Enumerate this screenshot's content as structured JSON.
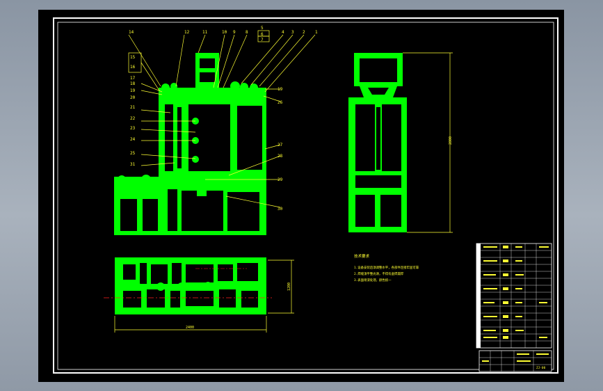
{
  "colors": {
    "background": "#000000",
    "part_fill": "#00ff00",
    "annotation": "#ffff33",
    "border": "#ffffff",
    "centerline": "#ff2020"
  },
  "drawing": {
    "callouts_top": [
      "14",
      "12",
      "11",
      "10",
      "9",
      "8",
      "7",
      "6",
      "5",
      "4",
      "3",
      "2",
      "1"
    ],
    "callouts_left": [
      "15",
      "16",
      "17",
      "18",
      "19",
      "20",
      "21",
      "22",
      "23",
      "24",
      "25",
      "31"
    ],
    "callouts_right": [
      "19",
      "26",
      "27",
      "28",
      "29",
      "30"
    ],
    "dim_width": "2400",
    "dim_depth": "1200",
    "dim_height": "2800",
    "notes_heading": "技术要求",
    "notes": [
      "1.设备安装后须调整水平，各部件连接牢固可靠",
      "2.焊缝须平整光滑，不得有虚焊漏焊",
      "3.表面喷漆处理，颜色统一"
    ],
    "title_block": {
      "drawing_no": "ZJ-00"
    }
  }
}
